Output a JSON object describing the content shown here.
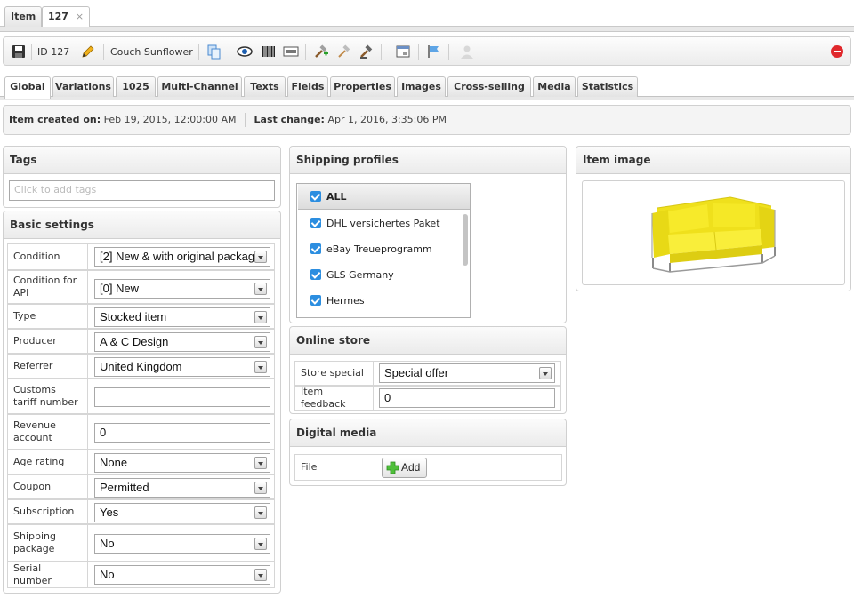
{
  "window_tabs": [
    {
      "label": "Item"
    },
    {
      "label": "127",
      "close": "×"
    }
  ],
  "toolbar": {
    "id_label": "ID 127",
    "item_name": "Couch Sunflower"
  },
  "section_tabs": [
    "Global",
    "Variations",
    "1025",
    "Multi-Channel",
    "Texts",
    "Fields",
    "Properties",
    "Images",
    "Cross-selling",
    "Media",
    "Statistics"
  ],
  "info": {
    "created_label": "Item created on:",
    "created_value": "Feb 19, 2015, 12:00:00 AM",
    "changed_label": "Last change:",
    "changed_value": "Apr 1, 2016, 3:35:06 PM"
  },
  "tags": {
    "title": "Tags",
    "placeholder": "Click to add tags"
  },
  "basic": {
    "title": "Basic settings",
    "rows": [
      {
        "label": "Condition",
        "value": "[2] New & with original packagi"
      },
      {
        "label": "Condition for API",
        "value": "[0] New"
      },
      {
        "label": "Type",
        "value": "Stocked item"
      },
      {
        "label": "Producer",
        "value": "A & C Design"
      },
      {
        "label": "Referrer",
        "value": "United Kingdom"
      },
      {
        "label": "Customs tariff number",
        "value": ""
      },
      {
        "label": "Revenue account",
        "value": "0"
      },
      {
        "label": "Age rating",
        "value": "None"
      },
      {
        "label": "Coupon",
        "value": "Permitted"
      },
      {
        "label": "Subscription",
        "value": "Yes"
      },
      {
        "label": "Shipping package",
        "value": "No"
      },
      {
        "label": "Serial number",
        "value": "No"
      }
    ]
  },
  "shipping": {
    "title": "Shipping profiles",
    "items": [
      "ALL",
      "DHL versichertes Paket",
      "eBay Treueprogramm",
      "GLS Germany",
      "Hermes"
    ]
  },
  "online_store": {
    "title": "Online store",
    "rows": [
      {
        "label": "Store special",
        "value": "Special offer"
      },
      {
        "label": "Item feedback",
        "value": "0"
      }
    ]
  },
  "digital_media": {
    "title": "Digital media",
    "file_label": "File",
    "add_label": "Add"
  },
  "item_image": {
    "title": "Item image"
  },
  "colors": {
    "accent": "#2c8ee0",
    "close_red": "#e0282c",
    "couch_yellow": "#f2e41a"
  }
}
